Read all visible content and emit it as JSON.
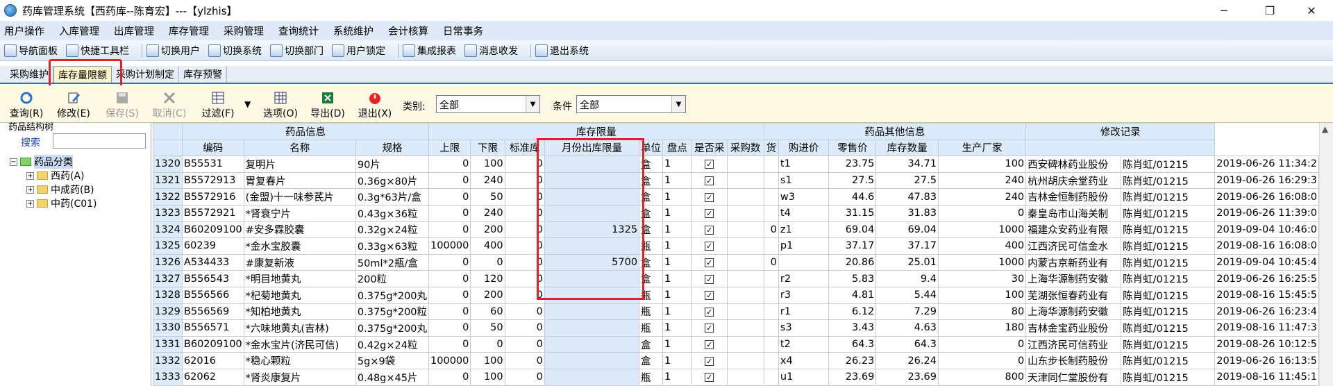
{
  "window": {
    "title": "药库管理系统【西药库--陈育宏】---【ylzhis】",
    "minimize": "─",
    "maximize": "❐",
    "close": "✕"
  },
  "menu": [
    "用户操作",
    "入库管理",
    "出库管理",
    "库存管理",
    "采购管理",
    "查询统计",
    "系统维护",
    "会计核算",
    "日常事务"
  ],
  "toolbar": [
    "导航面板",
    "快捷工具栏",
    "切换用户",
    "切换系统",
    "切换部门",
    "用户锁定",
    "集成报表",
    "消息收发",
    "退出系统"
  ],
  "tabs": [
    "采购维护",
    "库存量限额",
    "采购计划制定",
    "库存预警"
  ],
  "actions": {
    "query": "查询(R)",
    "modify": "修改(E)",
    "save": "保存(S)",
    "cancel": "取消(C)",
    "filter": "过滤(F)",
    "options": "选项(O)",
    "export": "导出(D)",
    "exit": "退出(X)"
  },
  "filters": {
    "category_label": "类别:",
    "category_value": "全部",
    "condition_label": "条件",
    "condition_value": "全部"
  },
  "tree": {
    "title": "药品结构树",
    "search_label": "搜索",
    "root": "药品分类",
    "children": [
      "西药(A)",
      "中成药(B)",
      "中药(C01)"
    ]
  },
  "grid": {
    "groups": [
      "药品信息",
      "库存限量",
      "药品其他信息",
      "修改记录"
    ],
    "headers": [
      "编码",
      "名称",
      "规格",
      "上限",
      "下限",
      "标准库",
      "月份出库限量",
      "单位",
      "盘点",
      "是否采",
      "采购数",
      "货",
      "购进价",
      "零售价",
      "库存数量",
      "生产厂家"
    ],
    "rows": [
      [
        "1320",
        "B55531",
        "复明片",
        "90片",
        "0",
        "100",
        "0",
        "",
        "盒",
        "1",
        "",
        "",
        "t1",
        "23.75",
        "34.71",
        "100",
        "西安碑林药业股份",
        "陈肖虹/01215",
        "2019-06-26 11:34:2"
      ],
      [
        "1321",
        "B5572913",
        "胃复春片",
        "0.36g×80片",
        "0",
        "240",
        "0",
        "",
        "盒",
        "1",
        "",
        "",
        "s1",
        "27.5",
        "27.5",
        "240",
        "杭州胡庆余堂药业",
        "陈肖虹/01215",
        "2019-06-26 16:29:3"
      ],
      [
        "1322",
        "B5572916",
        "(金盟)十一味参芪片",
        "0.3g*63片/盒",
        "0",
        "50",
        "0",
        "",
        "盒",
        "1",
        "",
        "",
        "w3",
        "44.6",
        "47.83",
        "240",
        "吉林金恒制药股份",
        "陈肖虹/01215",
        "2019-06-26 16:08:0"
      ],
      [
        "1323",
        "B5572921",
        "*肾衰宁片",
        "0.43g×36粒",
        "0",
        "240",
        "0",
        "",
        "盒",
        "1",
        "",
        "",
        "t4",
        "31.15",
        "31.83",
        "0",
        "秦皇岛市山海关制",
        "陈肖虹/01215",
        "2019-06-26 11:39:0"
      ],
      [
        "1324",
        "B60209100",
        "#安多霖胶囊",
        "0.32g×24粒",
        "0",
        "200",
        "0",
        "1325",
        "盒",
        "1",
        "",
        "0",
        "z1",
        "69.04",
        "69.04",
        "1000",
        "福建众安药业有限",
        "陈肖虹/01215",
        "2019-09-04 10:46:0"
      ],
      [
        "1325",
        "60239",
        "*金水宝胶囊",
        "0.33g×63粒",
        "100000",
        "400",
        "0",
        "",
        "瓶",
        "1",
        "",
        "",
        "p1",
        "37.17",
        "37.17",
        "400",
        "江西济民可信金水",
        "陈肖虹/01215",
        "2019-08-16 16:08:0"
      ],
      [
        "1326",
        "A534433",
        "#康复新液",
        "50ml*2瓶/盒",
        "0",
        "0",
        "0",
        "5700",
        "盒",
        "1",
        "",
        "0",
        "",
        "20.86",
        "25.01",
        "1000",
        "内蒙古京新药业有",
        "陈肖虹/01215",
        "2019-09-04 10:45:4"
      ],
      [
        "1327",
        "B556543",
        "*明目地黄丸",
        "200粒",
        "0",
        "120",
        "0",
        "",
        "盒",
        "1",
        "",
        "",
        "r2",
        "5.83",
        "9.4",
        "30",
        "上海华源制药安徽",
        "陈肖虹/01215",
        "2019-06-26 16:25:5"
      ],
      [
        "1328",
        "B556566",
        "*杞菊地黄丸",
        "0.375g*200丸",
        "0",
        "200",
        "0",
        "",
        "瓶",
        "1",
        "",
        "",
        "r3",
        "4.81",
        "5.44",
        "100",
        "芜湖张恒春药业有",
        "陈肖虹/01215",
        "2019-08-16 15:45:5"
      ],
      [
        "1329",
        "B556569",
        "*知柏地黄丸",
        "0.375g*200粒",
        "0",
        "60",
        "0",
        "",
        "瓶",
        "1",
        "",
        "",
        "r1",
        "6.12",
        "7.29",
        "80",
        "上海华源制药安徽",
        "陈肖虹/01215",
        "2019-06-26 16:23:4"
      ],
      [
        "1330",
        "B556571",
        "*六味地黄丸(吉林)",
        "0.375g*200丸",
        "0",
        "50",
        "0",
        "",
        "瓶",
        "1",
        "",
        "",
        "s3",
        "3.43",
        "4.63",
        "180",
        "吉林金宝药业股份",
        "陈肖虹/01215",
        "2019-08-16 11:47:3"
      ],
      [
        "1331",
        "B60209100",
        "*金水宝片(济民可信)",
        "0.42g×24粒",
        "0",
        "0",
        "0",
        "",
        "盒",
        "1",
        "",
        "",
        "t2",
        "64.3",
        "64.3",
        "0",
        "江西济民可信药业",
        "陈肖虹/01215",
        "2019-08-26 10:12:5"
      ],
      [
        "1332",
        "62016",
        "*稳心颗粒",
        "5g×9袋",
        "100000",
        "100",
        "0",
        "",
        "盒",
        "1",
        "",
        "",
        "x4",
        "26.23",
        "26.24",
        "0",
        "山东步长制药股份",
        "陈肖虹/01215",
        "2019-06-26 16:13:5"
      ],
      [
        "1333",
        "62062",
        "*肾炎康复片",
        "0.48g×45片",
        "0",
        "100",
        "0",
        "",
        "瓶",
        "1",
        "",
        "",
        "u1",
        "23.69",
        "23.69",
        "800",
        "天津同仁堂股份有",
        "陈肖虹/01215",
        "2019-08-16 11:45:1"
      ]
    ]
  },
  "colors": {
    "accent": "#3b6fb5",
    "highlight": "#e81e25",
    "header_bg": "#dcebfb"
  }
}
